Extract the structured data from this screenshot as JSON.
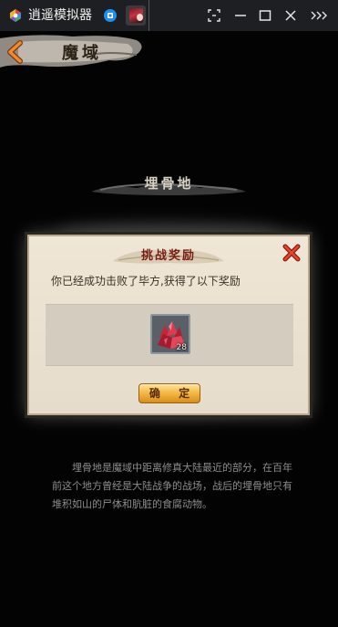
{
  "emulator": {
    "title": "逍遥模拟器",
    "icons": {
      "logo": "xiaoyao-logo-icon",
      "home_tab": "home-tab-icon",
      "game_tab": "game-avatar-icon",
      "screenshot": "screenshot-icon",
      "minimize": "minimize-icon",
      "maximize": "maximize-icon",
      "close": "close-icon",
      "more": "more-chevrons-icon"
    }
  },
  "game": {
    "header_title": "魔域",
    "location_title": "埋骨地",
    "description": "埋骨地是魔域中距离修真大陆最近的部分，在百年前这个地方曾经是大陆战争的战场，战后的埋骨地只有堆积如山的尸体和肮脏的食腐动物。",
    "colors": {
      "accent": "#d98d1a",
      "dialog_bg": "#efe6d6",
      "title_red": "#7a1d10"
    }
  },
  "dialog": {
    "title": "挑战奖励",
    "message": "你已经成功击败了毕方,获得了以下奖励",
    "reward": {
      "icon": "red-crystal-icon",
      "count": "28"
    },
    "confirm_label": "确 定"
  }
}
